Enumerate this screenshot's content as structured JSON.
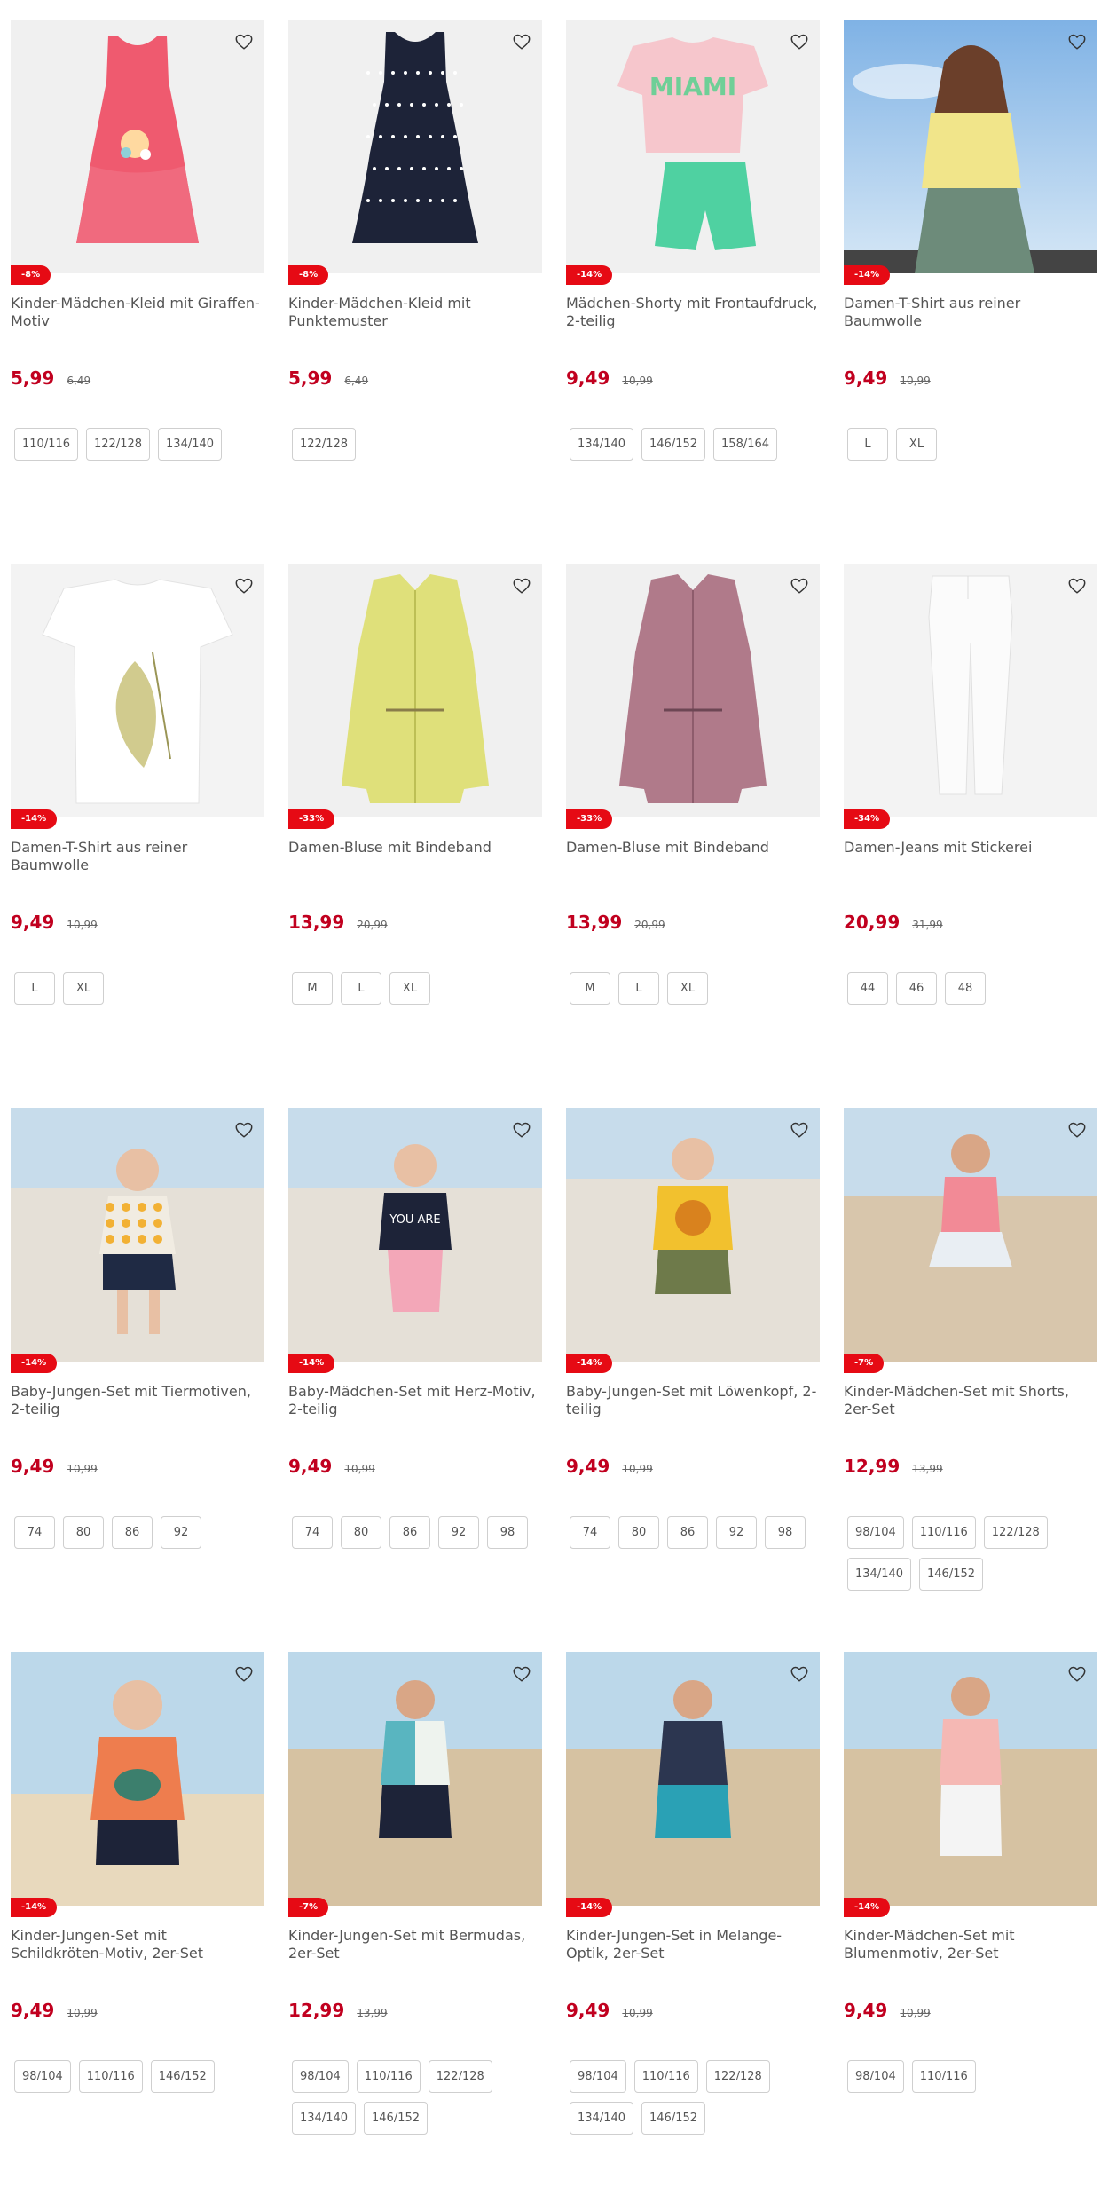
{
  "products": [
    {
      "badge": "-8%",
      "title": "Kinder-Mädchen-Kleid mit Giraffen-Motiv",
      "price": "5,99",
      "old_price": "6,49",
      "sizes": [
        "110/116",
        "122/128",
        "134/140"
      ],
      "image": "pink-dress"
    },
    {
      "badge": "-8%",
      "title": "Kinder-Mädchen-Kleid mit Punktemuster",
      "price": "5,99",
      "old_price": "6,49",
      "sizes": [
        "122/128"
      ],
      "image": "navy-dotted-dress"
    },
    {
      "badge": "-14%",
      "title": "Mädchen-Shorty mit Frontaufdruck, 2-teilig",
      "price": "9,49",
      "old_price": "10,99",
      "sizes": [
        "134/140",
        "146/152",
        "158/164"
      ],
      "image": "pink-tee-green-shorts"
    },
    {
      "badge": "-14%",
      "title": "Damen-T-Shirt aus reiner Baumwolle",
      "price": "9,49",
      "old_price": "10,99",
      "sizes": [
        "L",
        "XL"
      ],
      "image": "woman-yellow-tee"
    },
    {
      "badge": "-14%",
      "title": "Damen-T-Shirt aus reiner Baumwolle",
      "price": "9,49",
      "old_price": "10,99",
      "sizes": [
        "L",
        "XL"
      ],
      "image": "white-tee-leaf"
    },
    {
      "badge": "-33%",
      "title": "Damen-Bluse mit Bindeband",
      "price": "13,99",
      "old_price": "20,99",
      "sizes": [
        "M",
        "L",
        "XL"
      ],
      "image": "yellow-blouse"
    },
    {
      "badge": "-33%",
      "title": "Damen-Bluse mit Bindeband",
      "price": "13,99",
      "old_price": "20,99",
      "sizes": [
        "M",
        "L",
        "XL"
      ],
      "image": "mauve-blouse"
    },
    {
      "badge": "-34%",
      "title": "Damen-Jeans mit Stickerei",
      "price": "20,99",
      "old_price": "31,99",
      "sizes": [
        "44",
        "46",
        "48"
      ],
      "image": "white-jeans"
    },
    {
      "badge": "-14%",
      "title": "Baby-Jungen-Set mit Tiermotiven, 2-teilig",
      "price": "9,49",
      "old_price": "10,99",
      "sizes": [
        "74",
        "80",
        "86",
        "92"
      ],
      "image": "boy-beach-animal"
    },
    {
      "badge": "-14%",
      "title": "Baby-Mädchen-Set mit Herz-Motiv, 2-teilig",
      "price": "9,49",
      "old_price": "10,99",
      "sizes": [
        "74",
        "80",
        "86",
        "92",
        "98"
      ],
      "image": "girl-beach-love"
    },
    {
      "badge": "-14%",
      "title": "Baby-Jungen-Set mit Löwenkopf, 2-teilig",
      "price": "9,49",
      "old_price": "10,99",
      "sizes": [
        "74",
        "80",
        "86",
        "92",
        "98"
      ],
      "image": "boy-beach-lion"
    },
    {
      "badge": "-7%",
      "title": "Kinder-Mädchen-Set mit Shorts, 2er-Set",
      "price": "12,99",
      "old_price": "13,99",
      "sizes": [
        "98/104",
        "110/116",
        "122/128",
        "134/140",
        "146/152"
      ],
      "image": "girl-boardwalk"
    },
    {
      "badge": "-14%",
      "title": "Kinder-Jungen-Set mit Schildkröten-Motiv, 2er-Set",
      "price": "9,49",
      "old_price": "10,99",
      "sizes": [
        "98/104",
        "110/116",
        "146/152"
      ],
      "image": "boy-turtle"
    },
    {
      "badge": "-7%",
      "title": "Kinder-Jungen-Set mit Bermudas, 2er-Set",
      "price": "12,99",
      "old_price": "13,99",
      "sizes": [
        "98/104",
        "110/116",
        "122/128",
        "134/140",
        "146/152"
      ],
      "image": "boy-bermudas"
    },
    {
      "badge": "-14%",
      "title": "Kinder-Jungen-Set in Melange-Optik, 2er-Set",
      "price": "9,49",
      "old_price": "10,99",
      "sizes": [
        "98/104",
        "110/116",
        "122/128",
        "134/140",
        "146/152"
      ],
      "image": "boy-melange"
    },
    {
      "badge": "-14%",
      "title": "Kinder-Mädchen-Set mit Blumenmotiv, 2er-Set",
      "price": "9,49",
      "old_price": "10,99",
      "sizes": [
        "98/104",
        "110/116"
      ],
      "image": "girl-flower"
    }
  ],
  "colors": {
    "price": "#c1001f",
    "badge": "#e60a14",
    "text": "#555555",
    "border": "#cfcfcf"
  },
  "icons": {
    "favorite": "heart-outline-icon"
  }
}
